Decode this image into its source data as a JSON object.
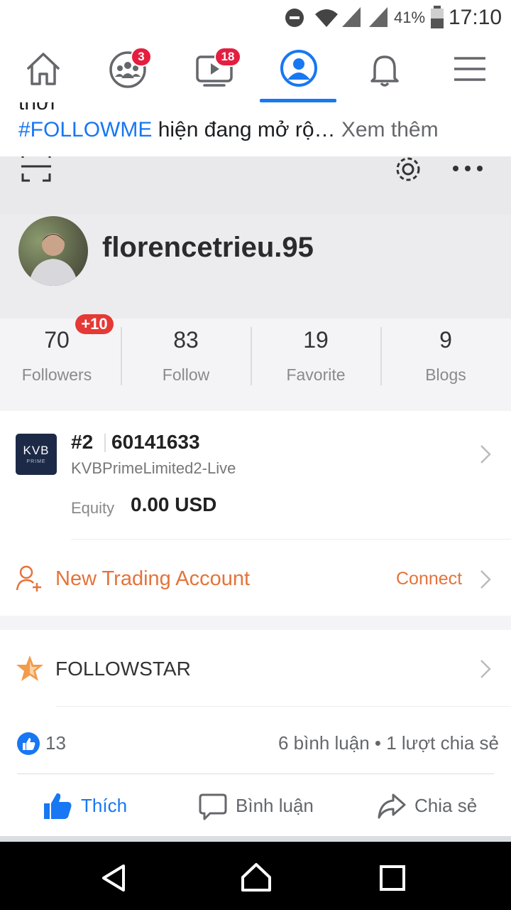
{
  "status_bar": {
    "battery": "41%",
    "time": "17:10"
  },
  "nav": {
    "groups_badge": "3",
    "watch_badge": "18"
  },
  "post": {
    "cut_line": "thời",
    "hashtag": "#FOLLOWME",
    "text": " hiện đang mở rộ…",
    "see_more": " Xem thêm"
  },
  "profile": {
    "username": "florencetrieu.95",
    "followers_badge": "+10",
    "stats": [
      {
        "value": "70",
        "label": "Followers"
      },
      {
        "value": "83",
        "label": "Follow"
      },
      {
        "value": "19",
        "label": "Favorite"
      },
      {
        "value": "9",
        "label": "Blogs"
      }
    ]
  },
  "account": {
    "logo_text": "KVB",
    "logo_sub": "PRIME",
    "rank": "#2",
    "id": "60141633",
    "name": "KVBPrimeLimited2-Live",
    "equity_label": "Equity",
    "equity_value": "0.00 USD",
    "new_account": "New Trading Account",
    "connect": "Connect",
    "followstar": "FOLLOWSTAR"
  },
  "reactions": {
    "likes": "13",
    "comments_shares": "6 bình luận • 1 lượt chia sẻ"
  },
  "actions": {
    "like": "Thích",
    "comment": "Bình luận",
    "share": "Chia sẻ"
  },
  "colors": {
    "facebook_blue": "#1877f2",
    "badge_red": "#e41e3f",
    "accent_orange": "#e5733a"
  }
}
